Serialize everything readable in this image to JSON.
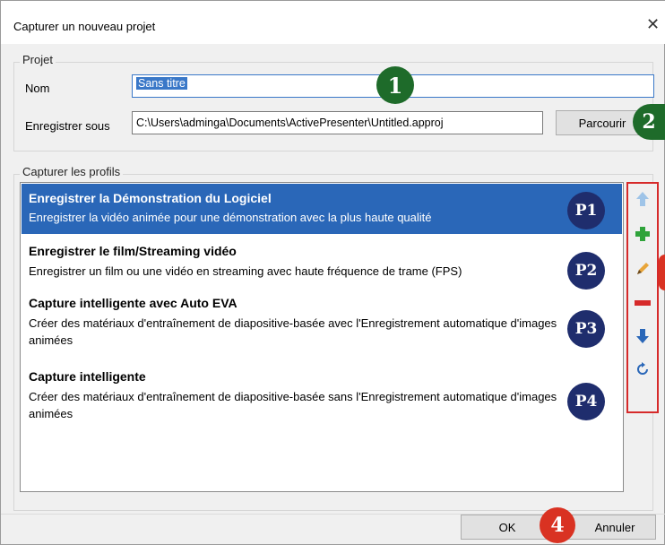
{
  "window": {
    "title": "Capturer un nouveau projet",
    "close_glyph": "✕"
  },
  "project": {
    "group_label": "Projet",
    "name_label": "Nom",
    "name_value": "Sans titre",
    "save_label": "Enregistrer sous",
    "save_path": "C:\\Users\\adminga\\Documents\\ActivePresenter\\Untitled.approj",
    "browse_label": "Parcourir"
  },
  "profiles": {
    "group_label": "Capturer les profils",
    "items": [
      {
        "title": "Enregistrer la Démonstration du Logiciel",
        "desc": "Enregistrer la vidéo animée pour une démonstration avec la plus haute qualité",
        "marker": "P1"
      },
      {
        "title": "Enregistrer le film/Streaming vidéo",
        "desc": "Enregistrer un film ou une vidéo en streaming avec haute fréquence de trame (FPS)",
        "marker": "P2"
      },
      {
        "title": "Capture intelligente avec Auto EVA",
        "desc": "Créer des matériaux d'entraînement de diapositive-basée avec l'Enregistrement automatique d'images animées",
        "marker": "P3"
      },
      {
        "title": "Capture intelligente",
        "desc": "Créer des matériaux d'entraînement de diapositive-basée sans l'Enregistrement automatique d'images animées",
        "marker": "P4"
      }
    ]
  },
  "toolbar": {
    "icons": [
      "arrow-up-icon",
      "plus-icon",
      "pencil-icon",
      "minus-icon",
      "arrow-down-icon",
      "reset-icon"
    ]
  },
  "footer": {
    "ok_label": "OK",
    "cancel_label": "Annuler"
  },
  "markers": {
    "m1": "1",
    "m2": "2",
    "m4": "4"
  },
  "colors": {
    "selection": "#2a67b8",
    "marker_green": "#1e6b2a",
    "marker_navy": "#1f2d6d",
    "marker_red": "#d93222",
    "toolbar_border": "#d62a2a"
  }
}
